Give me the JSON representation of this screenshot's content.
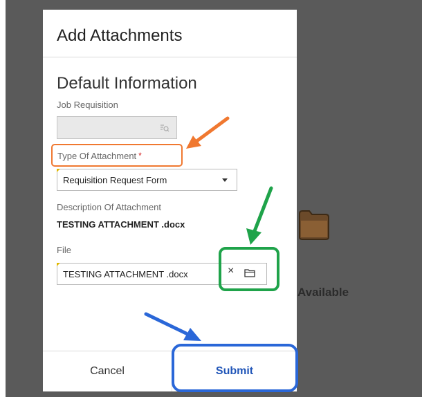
{
  "modal": {
    "title": "Add Attachments",
    "section_title": "Default Information",
    "job_requisition": {
      "label": "Job Requisition",
      "value": ""
    },
    "type_of_attachment": {
      "label": "Type Of Attachment",
      "required_marker": "*",
      "selected": "Requisition Request Form"
    },
    "description": {
      "label": "Description Of Attachment",
      "value": "TESTING ATTACHMENT .docx"
    },
    "file": {
      "label": "File",
      "value": "TESTING ATTACHMENT .docx",
      "clear_glyph": "×"
    },
    "cancel_label": "Cancel",
    "submit_label": "Submit"
  },
  "background": {
    "partial_text": "Available"
  },
  "icons": [
    "lookup-icon",
    "dropdown-arrow-icon",
    "clear-icon",
    "folder-icon",
    "folder-illustration"
  ],
  "colors": {
    "backdrop": "#5a5a5a",
    "required": "#d31b1b",
    "submit_text": "#2055b8",
    "annotation_orange": "#f07830",
    "annotation_green": "#1fa34a",
    "annotation_blue": "#2a67d8"
  }
}
